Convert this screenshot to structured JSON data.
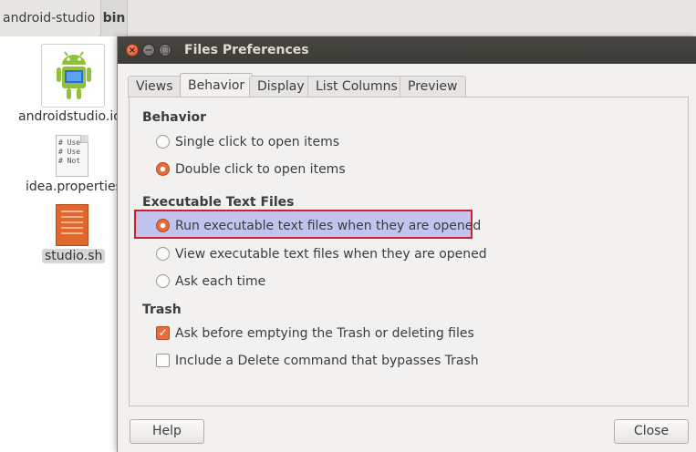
{
  "file_manager": {
    "path": [
      "android-studio",
      "bin"
    ],
    "files": [
      {
        "name": "androidstudio.ic",
        "icon": "android-icon"
      },
      {
        "name": "idea.properties",
        "icon": "text-file-icon",
        "preview_lines": [
          "# Use",
          "# Use",
          "# Not"
        ]
      },
      {
        "name": "studio.sh",
        "icon": "shell-script-icon"
      }
    ]
  },
  "dialog": {
    "title": "Files Preferences",
    "window_buttons": {
      "close": "×",
      "minimize": "−",
      "maximize": "□"
    },
    "tabs": [
      "Views",
      "Behavior",
      "Display",
      "List Columns",
      "Preview"
    ],
    "active_tab": "Behavior",
    "sections": {
      "behavior": {
        "title": "Behavior",
        "options": [
          "Single click to open items",
          "Double click to open items"
        ],
        "selected": "Double click to open items"
      },
      "executable": {
        "title": "Executable Text Files",
        "options": [
          "Run executable text files when they are opened",
          "View executable text files when they are opened",
          "Ask each time"
        ],
        "selected": "Run executable text files when they are opened"
      },
      "trash": {
        "title": "Trash",
        "options": [
          {
            "label": "Ask before emptying the Trash or deleting files",
            "checked": true
          },
          {
            "label": "Include a Delete command that bypasses Trash",
            "checked": false
          }
        ]
      }
    },
    "buttons": {
      "help": "Help",
      "close": "Close"
    }
  },
  "colors": {
    "accent": "#e86b3a",
    "highlight_fill": "#c3c3ef",
    "highlight_border": "#d0202f",
    "titlebar": "#3c3b37"
  }
}
